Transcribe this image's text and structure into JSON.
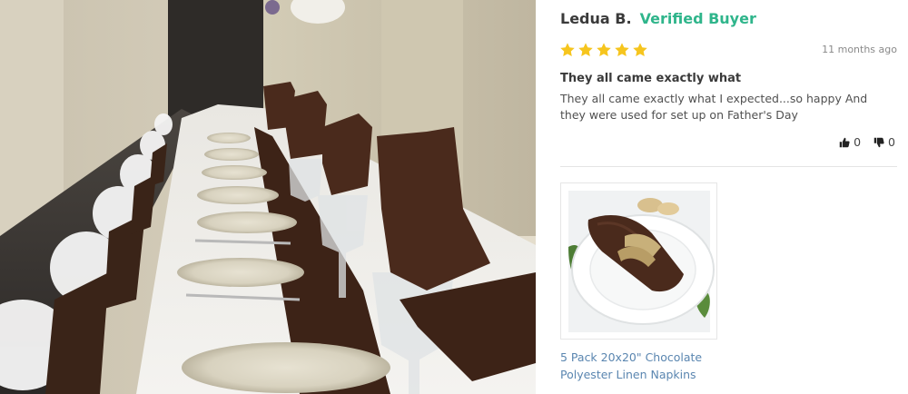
{
  "review": {
    "reviewer_name": "Ledua B.",
    "badge": "Verified Buyer",
    "rating": 5,
    "time_ago": "11 months ago",
    "title": "They all came exactly what",
    "body": "They all came exactly what I expected...so happy And they were used for set up on Father's Day",
    "helpful_count": "0",
    "unhelpful_count": "0"
  },
  "product": {
    "name_line1": "5 Pack 20x20\" Chocolate",
    "name_line2": "Polyester Linen Napkins"
  },
  "colors": {
    "verified": "#2fb58b",
    "star": "#f6c51e",
    "link": "#5a86b0",
    "napkin": "#4a2a1c"
  },
  "icons": {
    "thumbs_up": "thumbs-up-icon",
    "thumbs_down": "thumbs-down-icon",
    "star": "star-icon"
  }
}
